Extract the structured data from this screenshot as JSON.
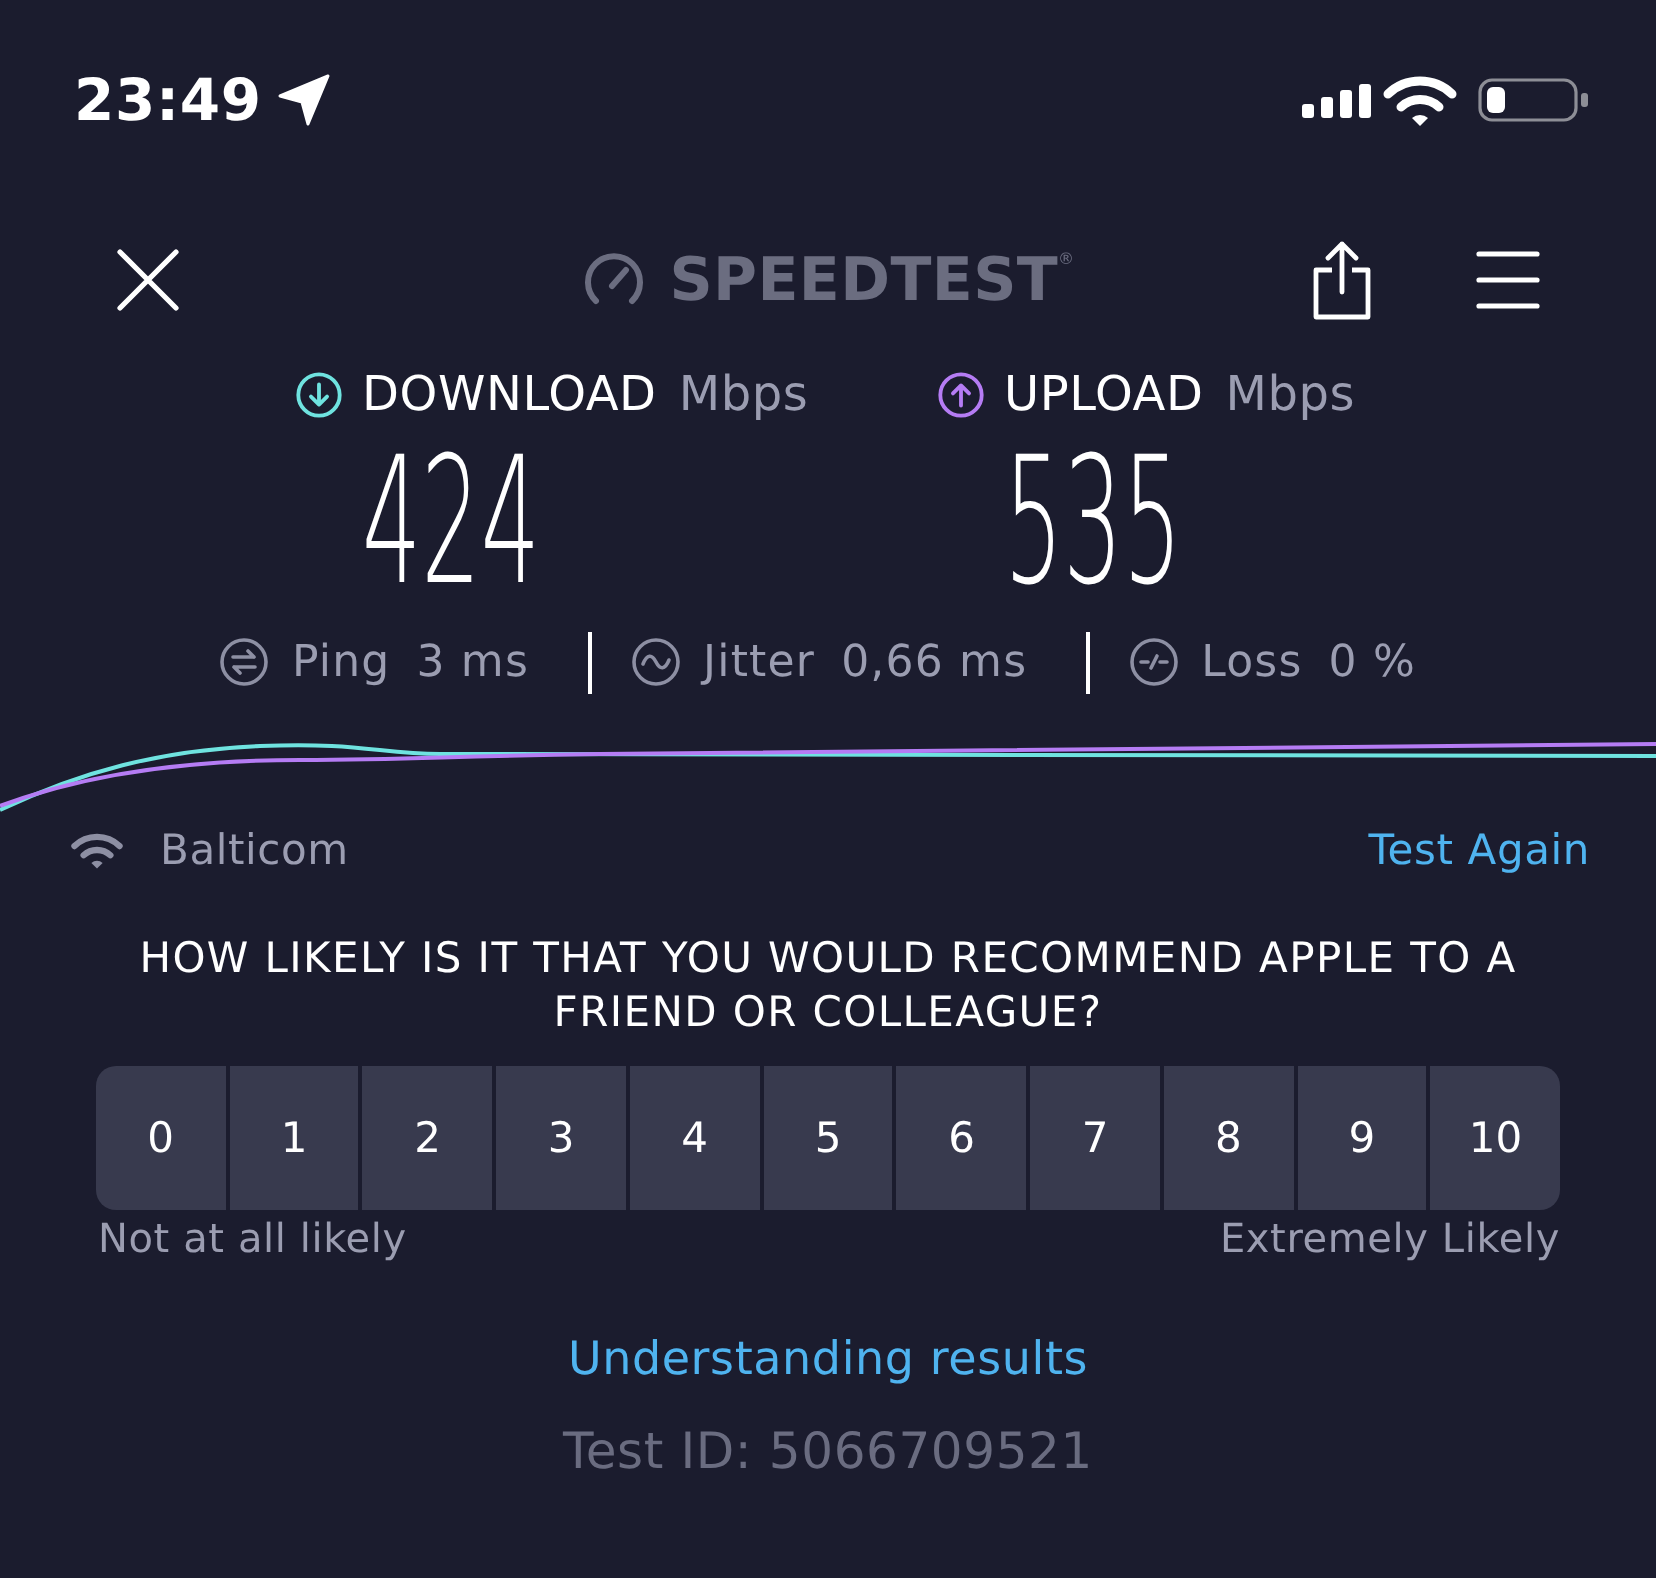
{
  "status_bar": {
    "time": "23:49"
  },
  "header": {
    "logo_text": "SPEEDTEST$^{®}$"
  },
  "results": [
    {
      "kind": "download",
      "label": "DOWNLOAD",
      "unit": "Mbps",
      "value": "424",
      "color": "#6fe3e0"
    },
    {
      "kind": "upload",
      "label": "UPLOAD",
      "unit": "Mbps",
      "value": "535",
      "color": "#b57cf4"
    }
  ],
  "metrics": [
    {
      "kind": "ping",
      "label": "Ping",
      "value": "3 ms"
    },
    {
      "kind": "jitter",
      "label": "Jitter",
      "value": "0,66 ms"
    },
    {
      "kind": "loss",
      "label": "Loss",
      "value": "0 %"
    }
  ],
  "network": {
    "name": "Balticom",
    "action": "Test Again"
  },
  "survey": {
    "question": "HOW LIKELY IS IT THAT YOU WOULD RECOMMEND APPLE TO A FRIEND OR COLLEAGUE?",
    "options": [
      {
        "label": "0",
        "selected": false
      },
      {
        "label": "1",
        "selected": false
      },
      {
        "label": "2",
        "selected": false
      },
      {
        "label": "3",
        "selected": false
      },
      {
        "label": "4",
        "selected": false
      },
      {
        "label": "5",
        "selected": false
      },
      {
        "label": "6",
        "selected": false
      },
      {
        "label": "7",
        "selected": false
      },
      {
        "label": "8",
        "selected": false
      },
      {
        "label": "9",
        "selected": false
      },
      {
        "label": "10",
        "selected": false
      }
    ],
    "min_label": "Not at all likely",
    "max_label": "Extremely Likely"
  },
  "footer": {
    "link": "Understanding results",
    "test_id": "Test ID: 5066709521"
  }
}
